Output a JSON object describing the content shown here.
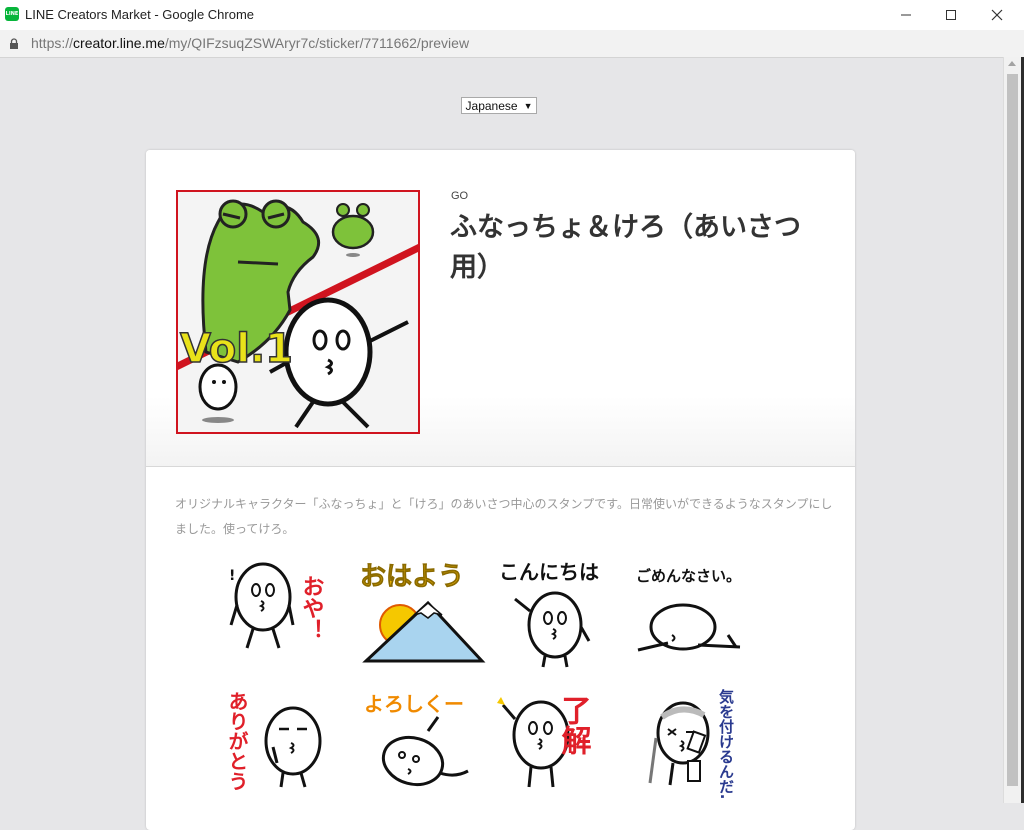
{
  "window": {
    "title": "LINE Creators Market - Google Chrome",
    "app_icon": "line-app-icon"
  },
  "address_bar": {
    "protocol": "https://",
    "host": "creator.line.me",
    "path": "/my/QIFzsuqZSWAryr7c/sticker/7711662/preview"
  },
  "language_select": {
    "value": "Japanese"
  },
  "product": {
    "creator": "GO",
    "title": "ふなっちょ＆けろ（あいさつ用）",
    "main_image_text": "Vol.1",
    "description": "オリジナルキャラクター「ふなっちょ」と「けろ」のあいさつ中心のスタンプです。日常使いができるようなスタンプにしました。使ってけろ。"
  },
  "stickers": [
    {
      "label": "おや！",
      "extra": "!",
      "color": "#e0202a"
    },
    {
      "label": "おはよう",
      "color": "#f0b400"
    },
    {
      "label": "こんにちは",
      "color": "#111111"
    },
    {
      "label": "ごめんなさい。",
      "color": "#111111"
    },
    {
      "label": "ありがとう",
      "color": "#e0202a"
    },
    {
      "label": "よろしくー",
      "color": "#f08a00"
    },
    {
      "label": "了解",
      "color": "#e0202a"
    },
    {
      "label": "気を付けるんだ…",
      "color": "#2a3a8f"
    }
  ],
  "colors": {
    "frog_green": "#7ec23a",
    "frame_red": "#d0141f",
    "vol_yellow": "#e9e21a"
  }
}
